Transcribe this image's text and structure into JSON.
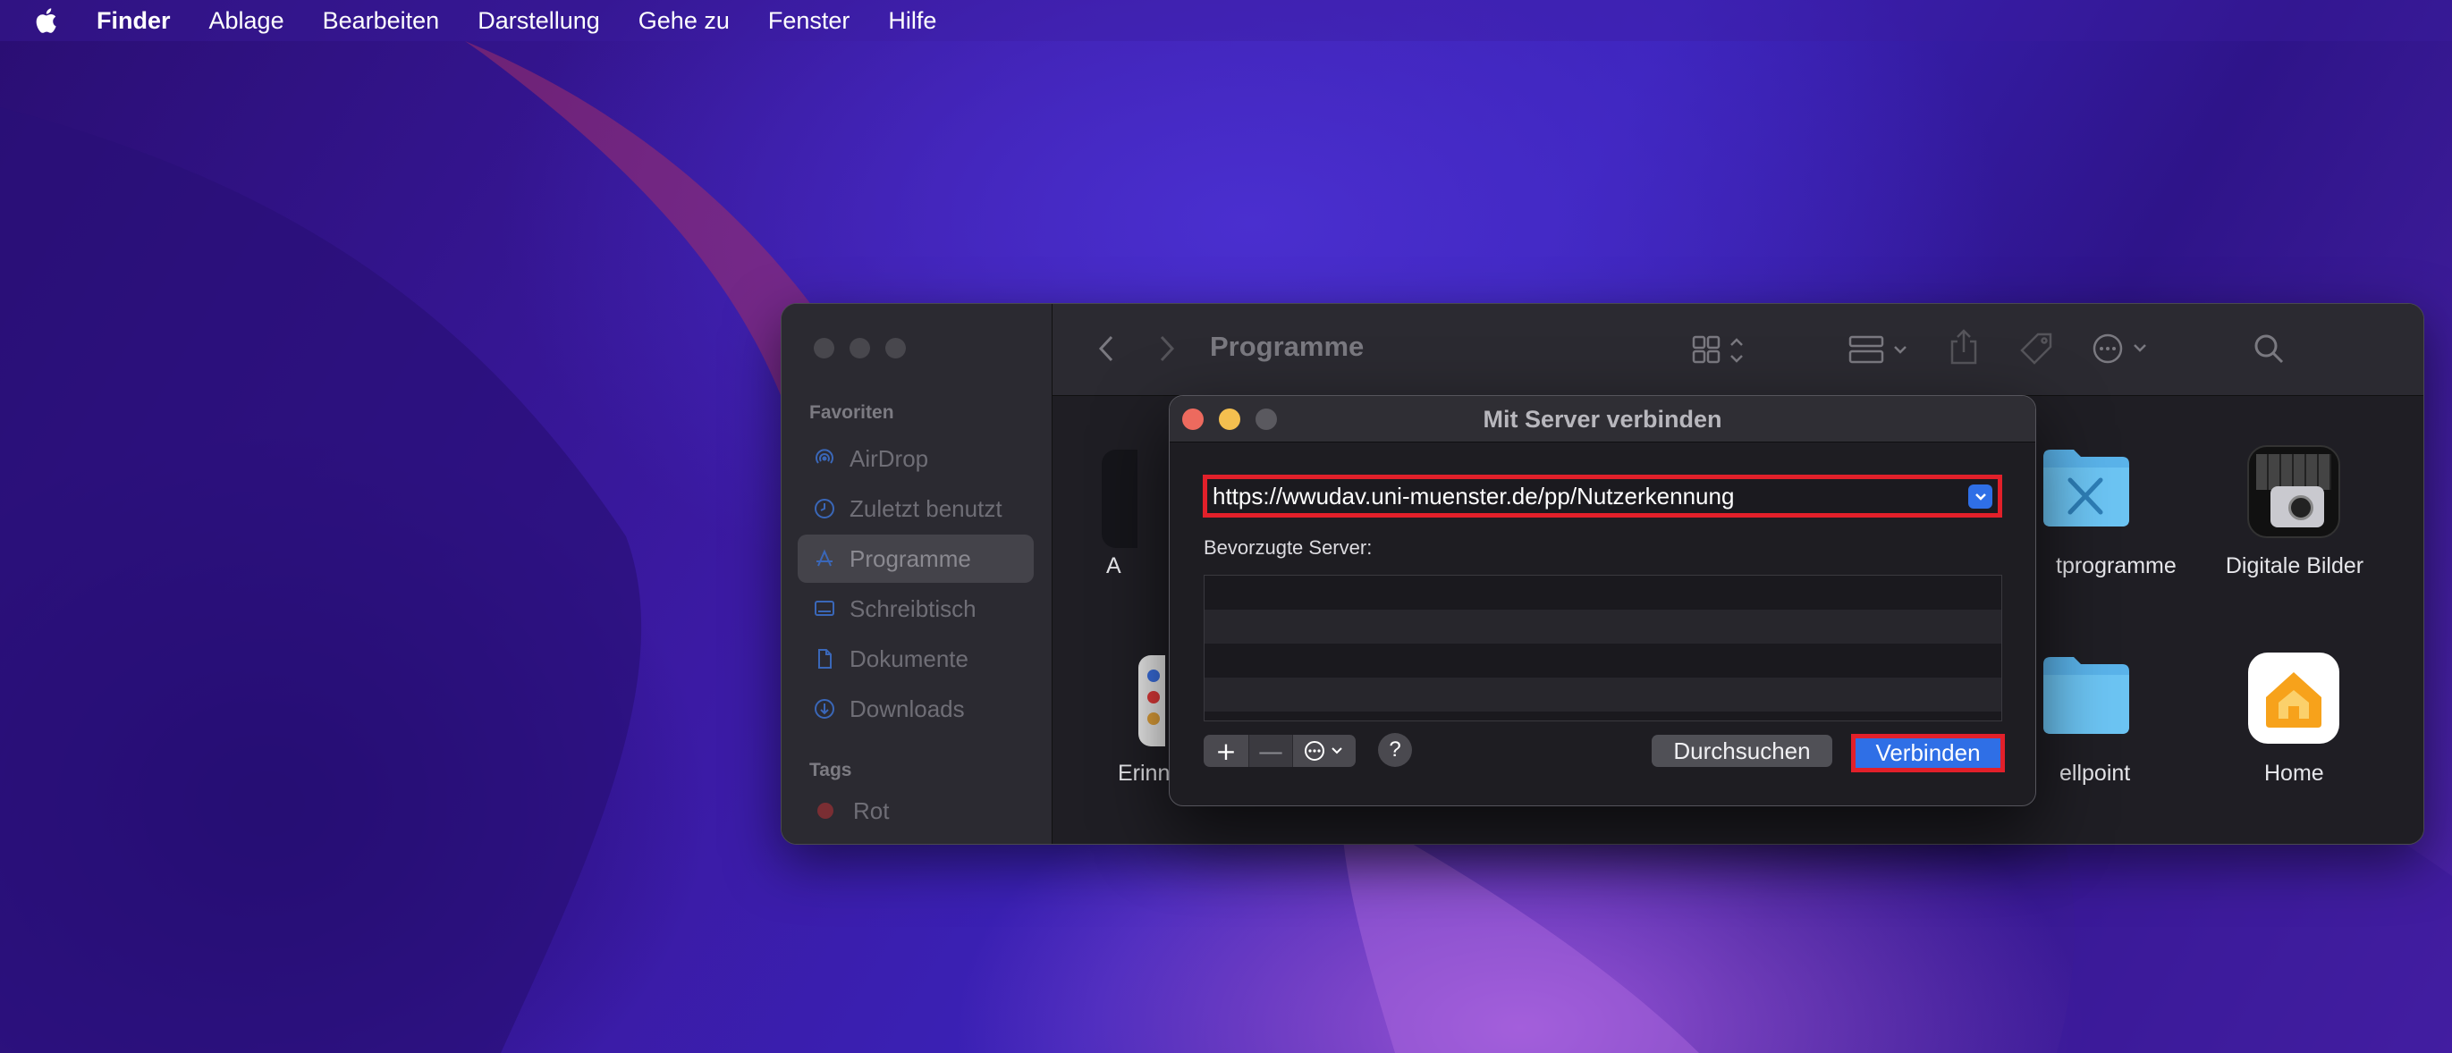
{
  "menubar": {
    "app": "Finder",
    "items": [
      "Ablage",
      "Bearbeiten",
      "Darstellung",
      "Gehe zu",
      "Fenster",
      "Hilfe"
    ]
  },
  "finder": {
    "title": "Programme",
    "sidebar": {
      "favorites_header": "Favoriten",
      "items": [
        {
          "label": "AirDrop",
          "icon": "airdrop-icon"
        },
        {
          "label": "Zuletzt benutzt",
          "icon": "clock-icon"
        },
        {
          "label": "Programme",
          "icon": "apps-icon"
        },
        {
          "label": "Schreibtisch",
          "icon": "desktop-icon"
        },
        {
          "label": "Dokumente",
          "icon": "document-icon"
        },
        {
          "label": "Downloads",
          "icon": "download-icon"
        }
      ],
      "tags_header": "Tags",
      "tags": [
        {
          "label": "Rot",
          "color": "#7a2e33"
        }
      ]
    },
    "apps": [
      {
        "label": "A"
      },
      {
        "label": "tprogramme"
      },
      {
        "label": "Digitale Bilder"
      },
      {
        "label": "Erinn"
      },
      {
        "label": "ellpoint"
      },
      {
        "label": "Home"
      }
    ]
  },
  "dialog": {
    "title": "Mit Server verbinden",
    "url_value": "https://wwudav.uni-muenster.de/pp/Nutzerkennung",
    "preferred_label": "Bevorzugte Server:",
    "add_symbol": "+",
    "remove_symbol": "—",
    "help_symbol": "?",
    "browse_label": "Durchsuchen",
    "connect_label": "Verbinden"
  },
  "colors": {
    "accent": "#2f6fe6",
    "highlight": "#e2202a",
    "close": "#ed6a5e",
    "minimize": "#f4bf4f",
    "zoom": "#5a595f"
  }
}
